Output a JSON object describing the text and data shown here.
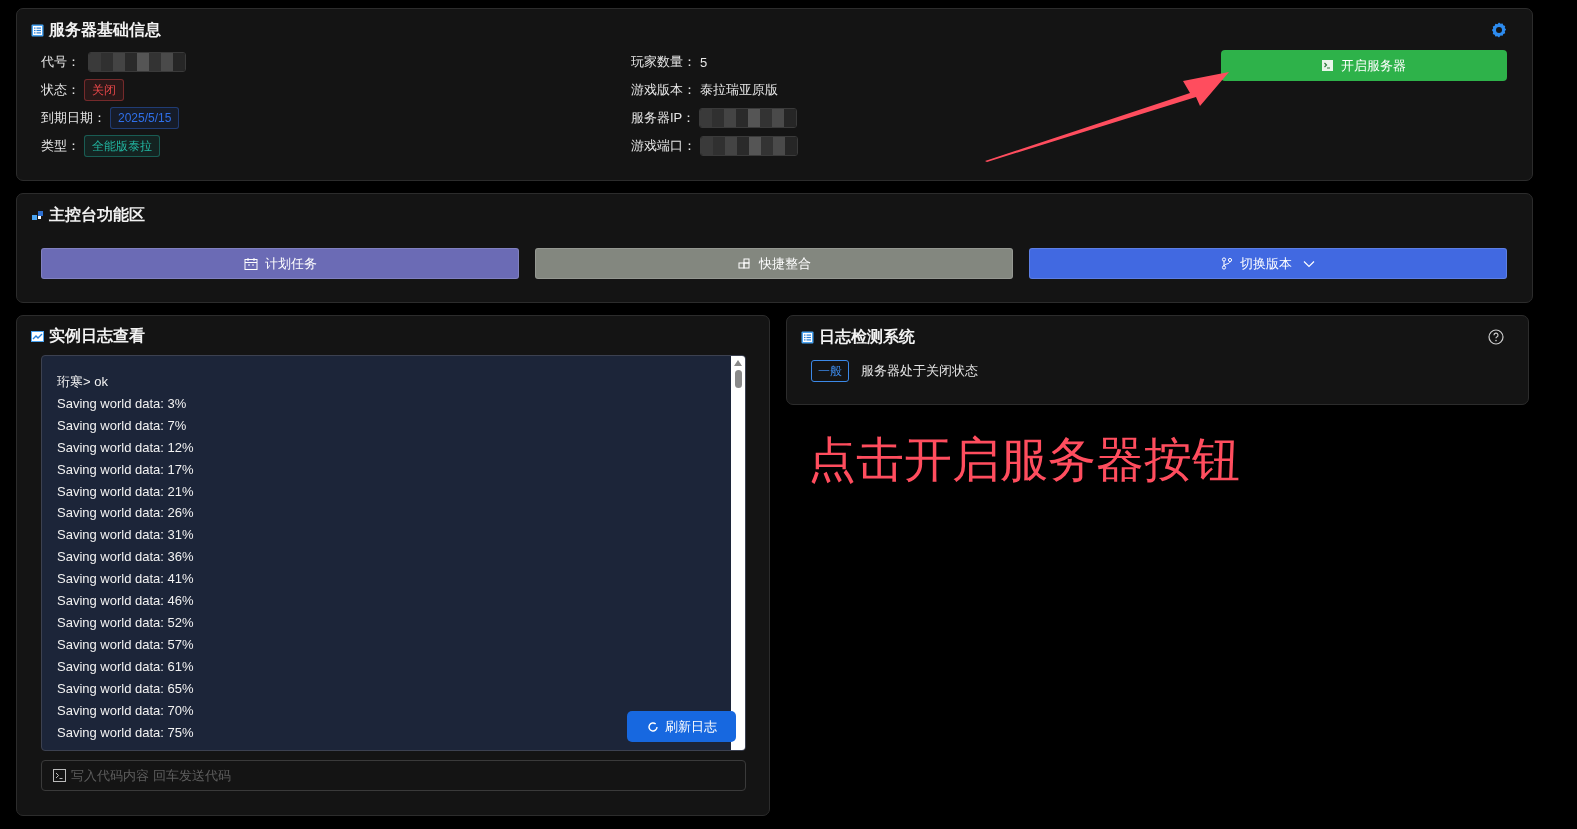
{
  "server_info": {
    "title": "服务器基础信息",
    "left_fields": [
      {
        "label": "代号：",
        "kind": "redacted"
      },
      {
        "label": "状态：",
        "kind": "tag",
        "value": "关闭",
        "color": "#e84749"
      },
      {
        "label": "到期日期：",
        "kind": "tag",
        "value": "2025/5/15",
        "color": "#2f6fe8"
      },
      {
        "label": "类型：",
        "kind": "tag",
        "value": "全能版泰拉",
        "color": "#22b5a0"
      }
    ],
    "right_fields": [
      {
        "label": "玩家数量：",
        "kind": "text",
        "value": "5"
      },
      {
        "label": "游戏版本：",
        "kind": "text",
        "value": "泰拉瑞亚原版"
      },
      {
        "label": "服务器IP：",
        "kind": "redacted"
      },
      {
        "label": "游戏端口：",
        "kind": "redacted"
      }
    ],
    "start_button": {
      "label": "开启服务器",
      "color": "#2eb24a"
    }
  },
  "console_panel": {
    "title": "主控台功能区",
    "buttons": [
      {
        "label": "计划任务",
        "color": "#6b6bb5",
        "dropdown": false
      },
      {
        "label": "快捷整合",
        "color": "#83877f",
        "dropdown": false
      },
      {
        "label": "切换版本",
        "color": "#4169e1",
        "dropdown": true
      }
    ]
  },
  "instance_log": {
    "title": "实例日志查看",
    "lines": [
      "珩寒> ok",
      "Saving world data: 3%",
      "Saving world data: 7%",
      "Saving world data: 12%",
      "Saving world data: 17%",
      "Saving world data: 21%",
      "Saving world data: 26%",
      "Saving world data: 31%",
      "Saving world data: 36%",
      "Saving world data: 41%",
      "Saving world data: 46%",
      "Saving world data: 52%",
      "Saving world data: 57%",
      "Saving world data: 61%",
      "Saving world data: 65%",
      "Saving world data: 70%",
      "Saving world data: 75%"
    ],
    "refresh_button": "刷新日志",
    "command_input": {
      "placeholder": "写入代码内容 回车发送代码"
    }
  },
  "log_detection": {
    "title": "日志检测系统",
    "entries": [
      {
        "level": "一般",
        "color": "#3c89e8",
        "message": "服务器处于关闭状态"
      }
    ]
  },
  "annotation": {
    "text": "点击开启服务器按钮"
  }
}
